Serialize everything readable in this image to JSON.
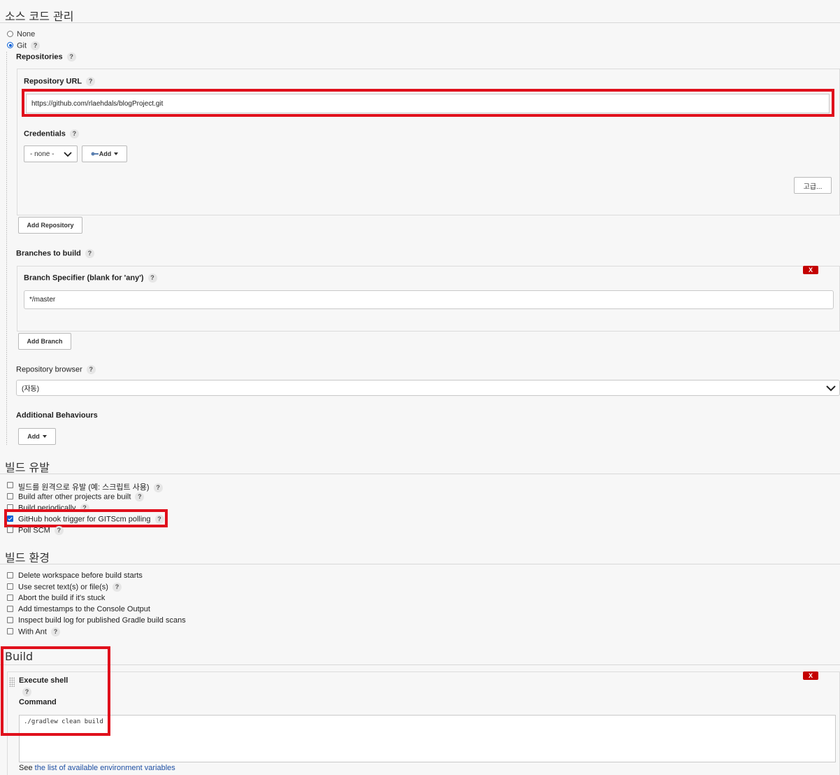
{
  "scm": {
    "title": "소스 코드 관리",
    "none_label": "None",
    "git_label": "Git",
    "repositories_label": "Repositories",
    "repo_url_label": "Repository URL",
    "repo_url_value": "https://github.com/rlaehdals/blogProject.git",
    "credentials_label": "Credentials",
    "credentials_selected": "- none -",
    "add_label": "Add",
    "advanced_label": "고급...",
    "add_repository_label": "Add Repository",
    "branches_label": "Branches to build",
    "branch_specifier_label": "Branch Specifier (blank for 'any')",
    "branch_value": "*/master",
    "x_label": "X",
    "add_branch_label": "Add Branch",
    "repo_browser_label": "Repository browser",
    "repo_browser_selected": "(자동)",
    "additional_behaviours_label": "Additional Behaviours",
    "add_button_label": "Add"
  },
  "triggers": {
    "title": "빌드 유발",
    "items": [
      {
        "label": "빌드를 원격으로 유발 (예: 스크립트 사용)",
        "checked": false,
        "help": true
      },
      {
        "label": "Build after other projects are built",
        "checked": false,
        "help": true
      },
      {
        "label": "Build periodically",
        "checked": false,
        "help": true
      },
      {
        "label": "GitHub hook trigger for GITScm polling",
        "checked": true,
        "help": true
      },
      {
        "label": "Poll SCM",
        "checked": false,
        "help": true
      }
    ]
  },
  "environment": {
    "title": "빌드 환경",
    "items": [
      {
        "label": "Delete workspace before build starts",
        "checked": false,
        "help": false
      },
      {
        "label": "Use secret text(s) or file(s)",
        "checked": false,
        "help": true
      },
      {
        "label": "Abort the build if it's stuck",
        "checked": false,
        "help": false
      },
      {
        "label": "Add timestamps to the Console Output",
        "checked": false,
        "help": false
      },
      {
        "label": "Inspect build log for published Gradle build scans",
        "checked": false,
        "help": false
      },
      {
        "label": "With Ant",
        "checked": false,
        "help": true
      }
    ]
  },
  "build": {
    "title": "Build",
    "step_label": "Execute shell",
    "command_label": "Command",
    "command_value": "./gradlew clean build",
    "x_label": "X",
    "see_label": "See",
    "env_link_label": "the list of available environment variables"
  },
  "colors": {
    "highlight": "#e0101c",
    "delete": "#c40000",
    "link": "#1e4fa3"
  }
}
